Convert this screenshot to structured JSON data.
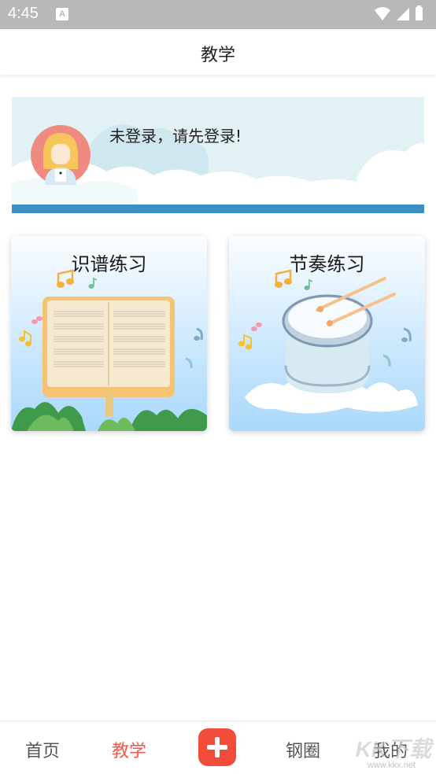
{
  "status_bar": {
    "time": "4:45",
    "indicator": "A",
    "icons": [
      "wifi-icon",
      "signal-icon",
      "battery-icon"
    ]
  },
  "header": {
    "title": "教学"
  },
  "banner": {
    "login_prompt": "未登录，请先登录!",
    "avatar": "avatar-girl-icon"
  },
  "cards": [
    {
      "title": "识谱练习",
      "image": "music-book-illustration"
    },
    {
      "title": "节奏练习",
      "image": "drum-illustration"
    }
  ],
  "tabbar": {
    "items": [
      "首页",
      "教学",
      "钢圈",
      "我的"
    ],
    "active_index": 1,
    "add_icon": "plus-icon"
  },
  "watermark": {
    "text": "KK下载",
    "sub": "www.kkx.net"
  },
  "colors": {
    "accent": "#f24d3b",
    "active_tab": "#f05a4a",
    "banner_bg": "#e2f1f4",
    "banner_strip": "#3b8fc2",
    "status_bar": "#b8b8b8"
  }
}
